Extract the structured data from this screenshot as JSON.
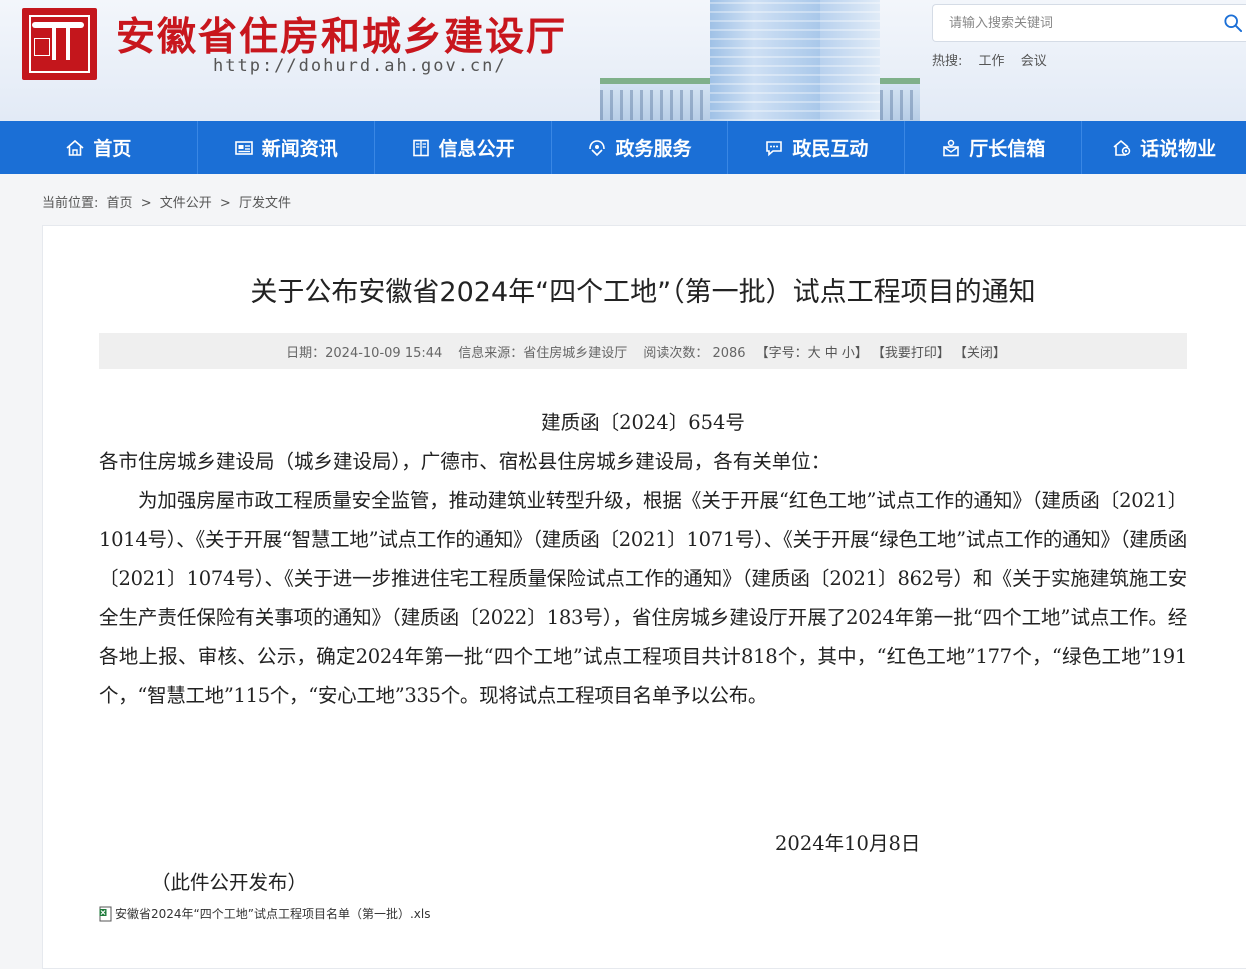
{
  "header": {
    "site_title": "安徽省住房和城乡建设厅",
    "site_url": "http://dohurd.ah.gov.cn/",
    "search_placeholder": "请输入搜索关键词",
    "hot_label": "热搜:",
    "hot_terms": [
      "工作",
      "会议"
    ]
  },
  "nav": [
    {
      "label": "首页",
      "icon": "home-icon"
    },
    {
      "label": "新闻资讯",
      "icon": "news-icon"
    },
    {
      "label": "信息公开",
      "icon": "document-icon"
    },
    {
      "label": "政务服务",
      "icon": "service-icon"
    },
    {
      "label": "政民互动",
      "icon": "chat-icon"
    },
    {
      "label": "厅长信箱",
      "icon": "mailbox-icon"
    },
    {
      "label": "话说物业",
      "icon": "property-icon"
    }
  ],
  "breadcrumb": {
    "label": "当前位置:",
    "items": [
      "首页",
      "文件公开",
      "厅发文件"
    ],
    "separator": ">"
  },
  "article": {
    "title": "关于公布安徽省2024年“四个工地”（第一批）试点工程项目的通知",
    "meta": {
      "date": "日期：2024-10-09 15:44",
      "source": "信息来源：省住房城乡建设厅",
      "views_label": "阅读次数：",
      "views": "2086",
      "font_size": "【字号：大 中 小】",
      "print": "【我要打印】",
      "close": "【关闭】"
    },
    "doc_number": "建质函〔2024〕654号",
    "addressee": "各市住房城乡建设局（城乡建设局），广德市、宿松县住房城乡建设局，各有关单位：",
    "paragraph": "为加强房屋市政工程质量安全监管，推动建筑业转型升级，根据《关于开展“红色工地”试点工作的通知》（建质函〔2021〕1014号）、《关于开展“智慧工地”试点工作的通知》（建质函〔2021〕1071号）、《关于开展“绿色工地”试点工作的通知》（建质函〔2021〕1074号）、《关于进一步推进住宅工程质量保险试点工作的通知》（建质函〔2021〕862号）和《关于实施建筑施工安全生产责任保险有关事项的通知》（建质函〔2022〕183号），省住房城乡建设厅开展了2024年第一批“四个工地”试点工作。经各地上报、审核、公示，确定2024年第一批“四个工地”试点工程项目共计818个，其中，“红色工地”177个，“绿色工地”191个，“智慧工地”115个，“安心工地”335个。现将试点工程项目名单予以公布。",
    "sign_date": "2024年10月8日",
    "publish_note": "（此件公开发布）",
    "attachment": "安徽省2024年“四个工地”试点工程项目名单（第一批）.xls"
  },
  "colors": {
    "brand_red": "#c8161d",
    "nav_blue": "#1b6fd6"
  }
}
